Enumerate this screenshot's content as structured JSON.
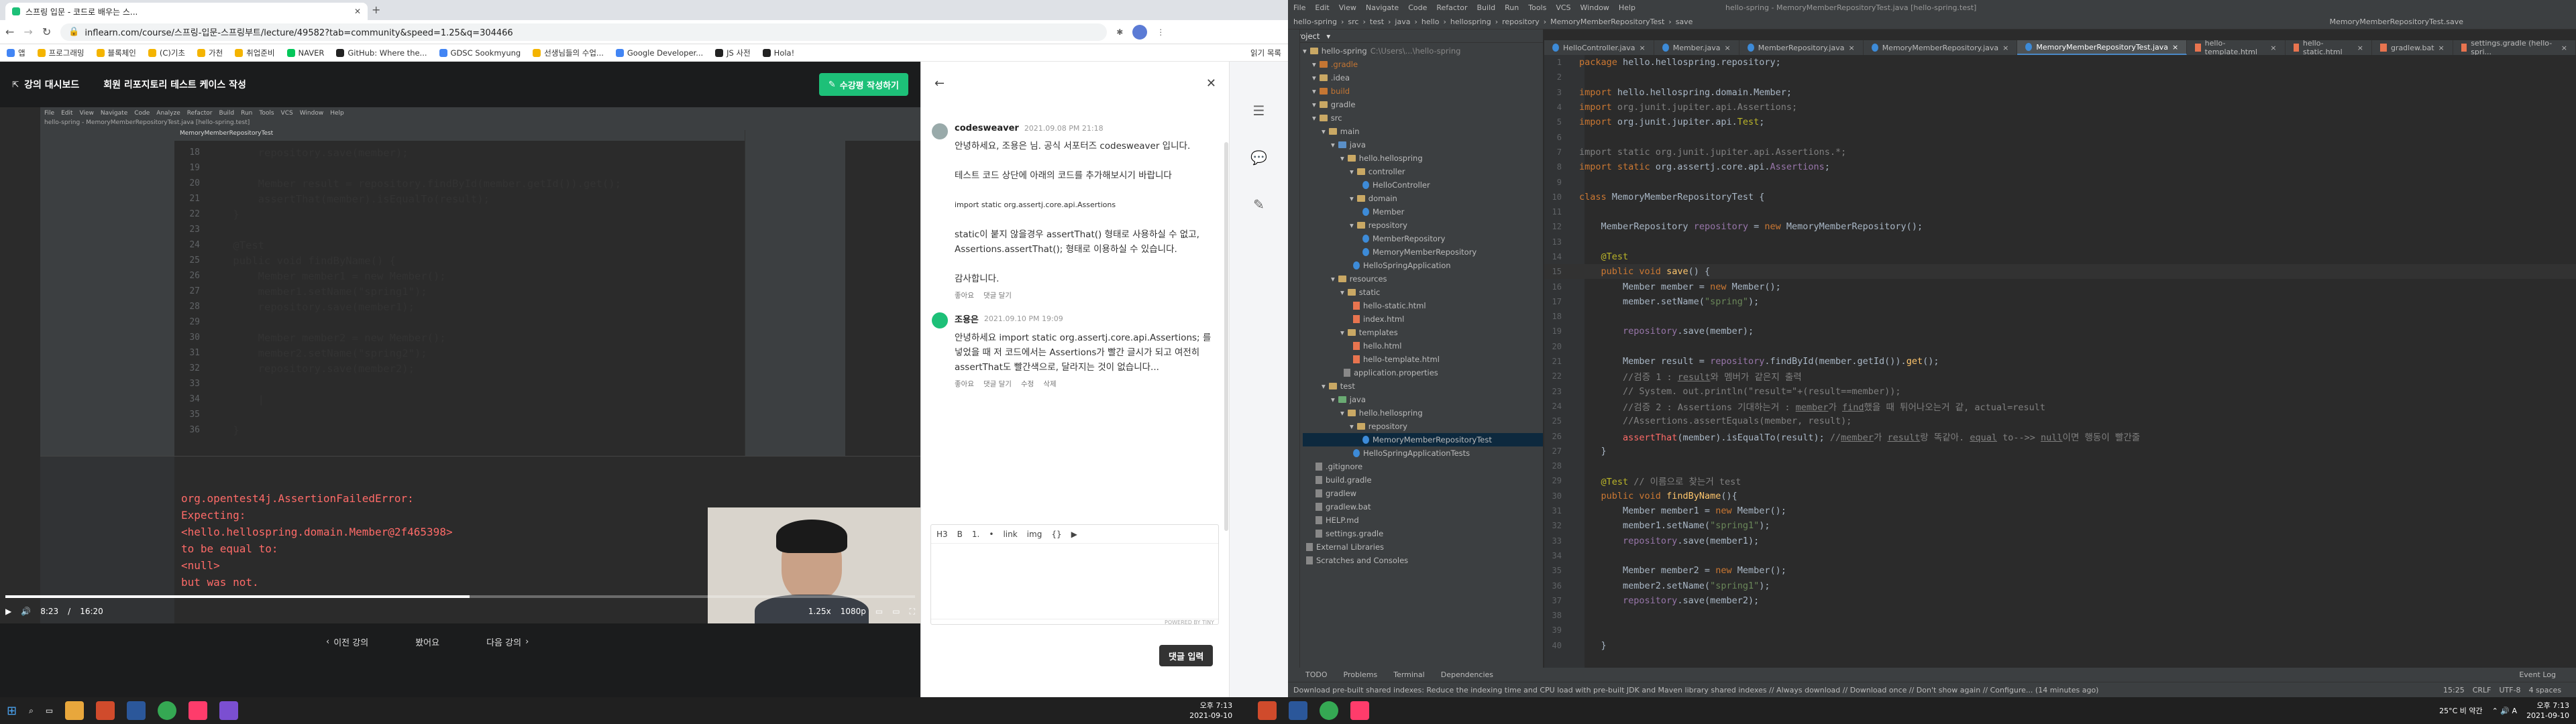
{
  "browser": {
    "tab_title": "스프링 입문 - 코드로 배우는 스...",
    "url": "inflearn.com/course/스프링-입문-스프링부트/lecture/49582?tab=community&speed=1.25&q=304466",
    "bookmarks": [
      "앱",
      "프로그래밍",
      "블록체인",
      "(C)기초",
      "가천",
      "취업준비",
      "NAVER",
      "GitHub: Where the...",
      "GDSC Sookmyung",
      "선생님들의 수업...",
      "Google Developer...",
      "JS 사전",
      "Hola!"
    ],
    "bookmark_other": "읽기 목록"
  },
  "lecture": {
    "dashboard_label": "강의 대시보드",
    "title": "회원 리포지토리 테스트 케이스 작성",
    "write_note_label": "수강평 작성하기",
    "prev_label": "이전 강의",
    "done_label": "봤어요",
    "next_label": "다음 강의",
    "time_current": "8:23",
    "time_total": "16:20",
    "speed": "1.25x",
    "quality": "1080p",
    "progress_fraction": 0.51,
    "mini_ide": {
      "title": "hello-spring - MemoryMemberRepositoryTest.java [hello-spring.test]",
      "menus": [
        "File",
        "Edit",
        "View",
        "Navigate",
        "Code",
        "Analyze",
        "Refactor",
        "Build",
        "Run",
        "Tools",
        "VCS",
        "Window",
        "Help"
      ],
      "tab": "MemoryMemberRepositoryTest",
      "code": [
        {
          "ln": "18",
          "text": "        repository.save(member);"
        },
        {
          "ln": "19",
          "text": ""
        },
        {
          "ln": "20",
          "text": "        Member result = repository.findById(member.getId()).get();"
        },
        {
          "ln": "21",
          "text": "        assertThat(member).isEqualTo(result);"
        },
        {
          "ln": "22",
          "text": "    }"
        },
        {
          "ln": "23",
          "text": ""
        },
        {
          "ln": "24",
          "text": "    @Test"
        },
        {
          "ln": "25",
          "text": "    public void findByName() {"
        },
        {
          "ln": "26",
          "text": "        Member member1 = new Member();"
        },
        {
          "ln": "27",
          "text": "        member1.setName(\"spring1\");"
        },
        {
          "ln": "28",
          "text": "        repository.save(member1);"
        },
        {
          "ln": "29",
          "text": ""
        },
        {
          "ln": "30",
          "text": "        Member member2 = new Member();"
        },
        {
          "ln": "31",
          "text": "        member2.setName(\"spring2\");"
        },
        {
          "ln": "32",
          "text": "        repository.save(member2);"
        },
        {
          "ln": "33",
          "text": ""
        },
        {
          "ln": "34",
          "text": "        |"
        },
        {
          "ln": "35",
          "text": ""
        },
        {
          "ln": "36",
          "text": "    }"
        }
      ],
      "error": [
        "org.opentest4j.AssertionFailedError:",
        "Expecting:",
        " <hello.hellospring.domain.Member@2f465398>",
        "to be equal to:",
        " <null>",
        "but was not."
      ]
    }
  },
  "comments": [
    {
      "author": "codesweaver",
      "date": "2021.09.08 PM 21:18",
      "body": [
        "안녕하세요, 조용은 님. 공식 서포터즈 codesweaver 입니다.",
        "",
        "테스트 코드 상단에 아래의 코드를 추가해보시기 바랍니다",
        "",
        "import static org.assertj.core.api.Assertions",
        "",
        "static이 붙지 않을경우 assertThat() 형태로 사용하실 수 없고, Assertions.assertThat(); 형태로 이용하실 수 있습니다.",
        "",
        "감사합니다."
      ],
      "actions": [
        "좋아요",
        "댓글 달기"
      ]
    },
    {
      "author": "조용은",
      "date": "2021.09.10 PM 19:09",
      "body": [
        "안녕하세요 import static org.assertj.core.api.Assertions; 를 넣었을 때 저 코드에서는 Assertions가 빨간 글시가 되고 여전히 assertThat도 빨간색으로, 달라지는 것이 없습니다..."
      ],
      "actions": [
        "좋아요",
        "댓글 달기",
        "수정",
        "삭제"
      ]
    }
  ],
  "editor_toolbar": [
    "H3",
    "B",
    "1.",
    "•",
    "link",
    "img",
    "{}",
    "▶"
  ],
  "powered_by": "POWERED BY TINY",
  "reply_label": "댓글 입력",
  "ide": {
    "title": "hello-spring - MemoryMemberRepositoryTest.java [hello-spring.test]",
    "menus": [
      "File",
      "Edit",
      "View",
      "Navigate",
      "Code",
      "Refactor",
      "Build",
      "Run",
      "Tools",
      "VCS",
      "Window",
      "Help"
    ],
    "breadcrumb": [
      "hello-spring",
      "src",
      "test",
      "java",
      "hello",
      "hellospring",
      "repository",
      "MemoryMemberRepositoryTest",
      "save"
    ],
    "run_config": "MemoryMemberRepositoryTest.save",
    "tabs": [
      "HelloController.java",
      "Member.java",
      "MemberRepository.java",
      "MemoryMemberRepository.java",
      "MemoryMemberRepositoryTest.java",
      "hello-template.html",
      "hello-static.html",
      "gradlew.bat",
      "settings.gradle (hello-spri..."
    ],
    "project_label": "Project",
    "tree": [
      {
        "d": 0,
        "t": "hello-spring",
        "k": "folder",
        "note": "C:\\Users\\...\\hello-spring"
      },
      {
        "d": 1,
        "t": ".gradle",
        "k": "orange"
      },
      {
        "d": 1,
        "t": ".idea",
        "k": "folder"
      },
      {
        "d": 1,
        "t": "build",
        "k": "orange"
      },
      {
        "d": 1,
        "t": "gradle",
        "k": "folder"
      },
      {
        "d": 1,
        "t": "src",
        "k": "folder"
      },
      {
        "d": 2,
        "t": "main",
        "k": "folder"
      },
      {
        "d": 3,
        "t": "java",
        "k": "blue"
      },
      {
        "d": 4,
        "t": "hello.hellospring",
        "k": "folder"
      },
      {
        "d": 5,
        "t": "controller",
        "k": "folder"
      },
      {
        "d": 6,
        "t": "HelloController",
        "k": "java"
      },
      {
        "d": 5,
        "t": "domain",
        "k": "folder"
      },
      {
        "d": 6,
        "t": "Member",
        "k": "java"
      },
      {
        "d": 5,
        "t": "repository",
        "k": "folder"
      },
      {
        "d": 6,
        "t": "MemberRepository",
        "k": "java"
      },
      {
        "d": 6,
        "t": "MemoryMemberRepository",
        "k": "java"
      },
      {
        "d": 5,
        "t": "HelloSpringApplication",
        "k": "java"
      },
      {
        "d": 3,
        "t": "resources",
        "k": "folder"
      },
      {
        "d": 4,
        "t": "static",
        "k": "folder"
      },
      {
        "d": 5,
        "t": "hello-static.html",
        "k": "html"
      },
      {
        "d": 5,
        "t": "index.html",
        "k": "html"
      },
      {
        "d": 4,
        "t": "templates",
        "k": "folder"
      },
      {
        "d": 5,
        "t": "hello.html",
        "k": "html"
      },
      {
        "d": 5,
        "t": "hello-template.html",
        "k": "html"
      },
      {
        "d": 4,
        "t": "application.properties",
        "k": "file"
      },
      {
        "d": 2,
        "t": "test",
        "k": "folder"
      },
      {
        "d": 3,
        "t": "java",
        "k": "green"
      },
      {
        "d": 4,
        "t": "hello.hellospring",
        "k": "folder"
      },
      {
        "d": 5,
        "t": "repository",
        "k": "folder"
      },
      {
        "d": 6,
        "t": "MemoryMemberRepositoryTest",
        "k": "java"
      },
      {
        "d": 5,
        "t": "HelloSpringApplicationTests",
        "k": "java"
      },
      {
        "d": 1,
        "t": ".gitignore",
        "k": "file"
      },
      {
        "d": 1,
        "t": "build.gradle",
        "k": "file"
      },
      {
        "d": 1,
        "t": "gradlew",
        "k": "file"
      },
      {
        "d": 1,
        "t": "gradlew.bat",
        "k": "file"
      },
      {
        "d": 1,
        "t": "HELP.md",
        "k": "file"
      },
      {
        "d": 1,
        "t": "settings.gradle",
        "k": "file"
      },
      {
        "d": 0,
        "t": "External Libraries",
        "k": "file"
      },
      {
        "d": 0,
        "t": "Scratches and Consoles",
        "k": "file"
      }
    ],
    "code": [
      {
        "ln": "1",
        "html": "<span class='kw'>package</span> hello.hellospring.repository;"
      },
      {
        "ln": "2",
        "html": ""
      },
      {
        "ln": "3",
        "html": "<span class='kw'>import</span> hello.hellospring.domain.Member;"
      },
      {
        "ln": "4",
        "html": "<span class='kw'>import</span> <span class='cm'>org.junit.jupiter.api.Assertions;</span>"
      },
      {
        "ln": "5",
        "html": "<span class='kw'>import</span> org.junit.jupiter.api.<span class='an'>Test</span>;"
      },
      {
        "ln": "6",
        "html": ""
      },
      {
        "ln": "7",
        "html": "<span class='cm'>import static org.junit.jupiter.api.Assertions.*;</span>"
      },
      {
        "ln": "8",
        "html": "<span class='kw'>import static</span> org.assertj.core.api.<span class='pur'>Assertions</span>;"
      },
      {
        "ln": "9",
        "html": ""
      },
      {
        "ln": "10",
        "html": "<span class='kw'>class</span> MemoryMemberRepositoryTest {"
      },
      {
        "ln": "11",
        "html": ""
      },
      {
        "ln": "12",
        "html": "    MemberRepository <span class='pur'>repository</span> = <span class='kw'>new</span> MemoryMemberRepository();"
      },
      {
        "ln": "13",
        "html": ""
      },
      {
        "ln": "14",
        "html": "    <span class='an'>@Test</span>"
      },
      {
        "ln": "15",
        "html": "    <span class='kw'>public void</span> <span class='fn'>save</span>() {"
      },
      {
        "ln": "16",
        "html": "        Member member = <span class='kw'>new</span> Member();"
      },
      {
        "ln": "17",
        "html": "        member.setName(<span class='str'>\"spring\"</span>);"
      },
      {
        "ln": "18",
        "html": ""
      },
      {
        "ln": "19",
        "html": "        <span class='pur'>repository</span>.save(member);"
      },
      {
        "ln": "20",
        "html": ""
      },
      {
        "ln": "21",
        "html": "        Member result = <span class='pur'>repository</span>.findById(member.getId()).<span class='fn'>get</span>();"
      },
      {
        "ln": "22",
        "html": "        <span class='cm'>//검증 1 : <span class='und'>result</span>와 멤버가 같은지 출력</span>"
      },
      {
        "ln": "23",
        "html": "        <span class='cm'>// System. out.println(\"result=\"+(result==member));</span>"
      },
      {
        "ln": "24",
        "html": "        <span class='cm'>//검증 2 : Assertions 기대하는거 : <span class='und'>member</span>가 <span class='und'>find</span>했을 때 튀어나오는거 같, actual=result</span>"
      },
      {
        "ln": "25",
        "html": "        <span class='cm'>//Assertions.assertEquals(member, result);</span>"
      },
      {
        "ln": "26",
        "html": "        <span style='color:#ff6b68'>assertThat</span>(member).isEqualTo(result); <span class='cm'>//<span class='und'>member</span>가 <span class='und'>result</span>랑 똑같아. <span class='und'>equal</span> to-->&gt; <span class='und'>null</span>이면 행동이 빨간줄</span>"
      },
      {
        "ln": "27",
        "html": "    }"
      },
      {
        "ln": "28",
        "html": ""
      },
      {
        "ln": "29",
        "html": "    <span class='an'>@Test</span> <span class='cm'>// 이름으로 찾는거 test</span>"
      },
      {
        "ln": "30",
        "html": "    <span class='kw'>public void</span> <span class='fn'>findByName</span>(){"
      },
      {
        "ln": "31",
        "html": "        Member member1 = <span class='kw'>new</span> Member();"
      },
      {
        "ln": "32",
        "html": "        member1.setName(<span class='str'>\"spring1\"</span>);"
      },
      {
        "ln": "33",
        "html": "        <span class='pur'>repository</span>.save(member1);"
      },
      {
        "ln": "34",
        "html": ""
      },
      {
        "ln": "35",
        "html": "        Member member2 = <span class='kw'>new</span> Member();"
      },
      {
        "ln": "36",
        "html": "        member2.setName(<span class='str'>\"spring1\"</span>);"
      },
      {
        "ln": "37",
        "html": "        <span class='pur'>repository</span>.save(member2);"
      },
      {
        "ln": "38",
        "html": ""
      },
      {
        "ln": "39",
        "html": ""
      },
      {
        "ln": "40",
        "html": "    }"
      }
    ],
    "bottom_tabs": [
      "TODO",
      "Problems",
      "Terminal",
      "Dependencies"
    ],
    "event_log": "Event Log",
    "status_msg": "Download pre-built shared indexes: Reduce the indexing time and CPU load with pre-built JDK and Maven library shared indexes // Always download // Download once // Don't show again // Configure... (14 minutes ago)",
    "status_right": [
      "15:25",
      "CRLF",
      "UTF-8",
      "4 spaces"
    ]
  },
  "taskbar": {
    "weather": "25°C 비 약간",
    "time_left": "오후 7:13",
    "date_left": "2021-09-10",
    "time_right": "오후 7:13",
    "date_right": "2021-09-10"
  }
}
